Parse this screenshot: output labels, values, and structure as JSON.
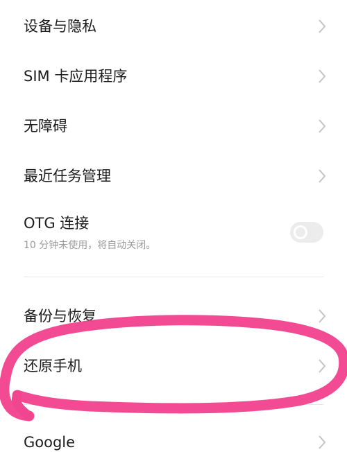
{
  "settings": {
    "items": [
      {
        "label": "设备与隐私"
      },
      {
        "label": "SIM 卡应用程序"
      },
      {
        "label": "无障碍"
      },
      {
        "label": "最近任务管理"
      },
      {
        "label": "OTG 连接",
        "subtitle": "10 分钟未使用，将自动关闭。",
        "toggle": "off"
      },
      {
        "label": "备份与恢复"
      },
      {
        "label": "还原手机"
      },
      {
        "label": "Google"
      }
    ]
  },
  "annotation": {
    "color": "#f2458f",
    "target": "还原手机"
  }
}
